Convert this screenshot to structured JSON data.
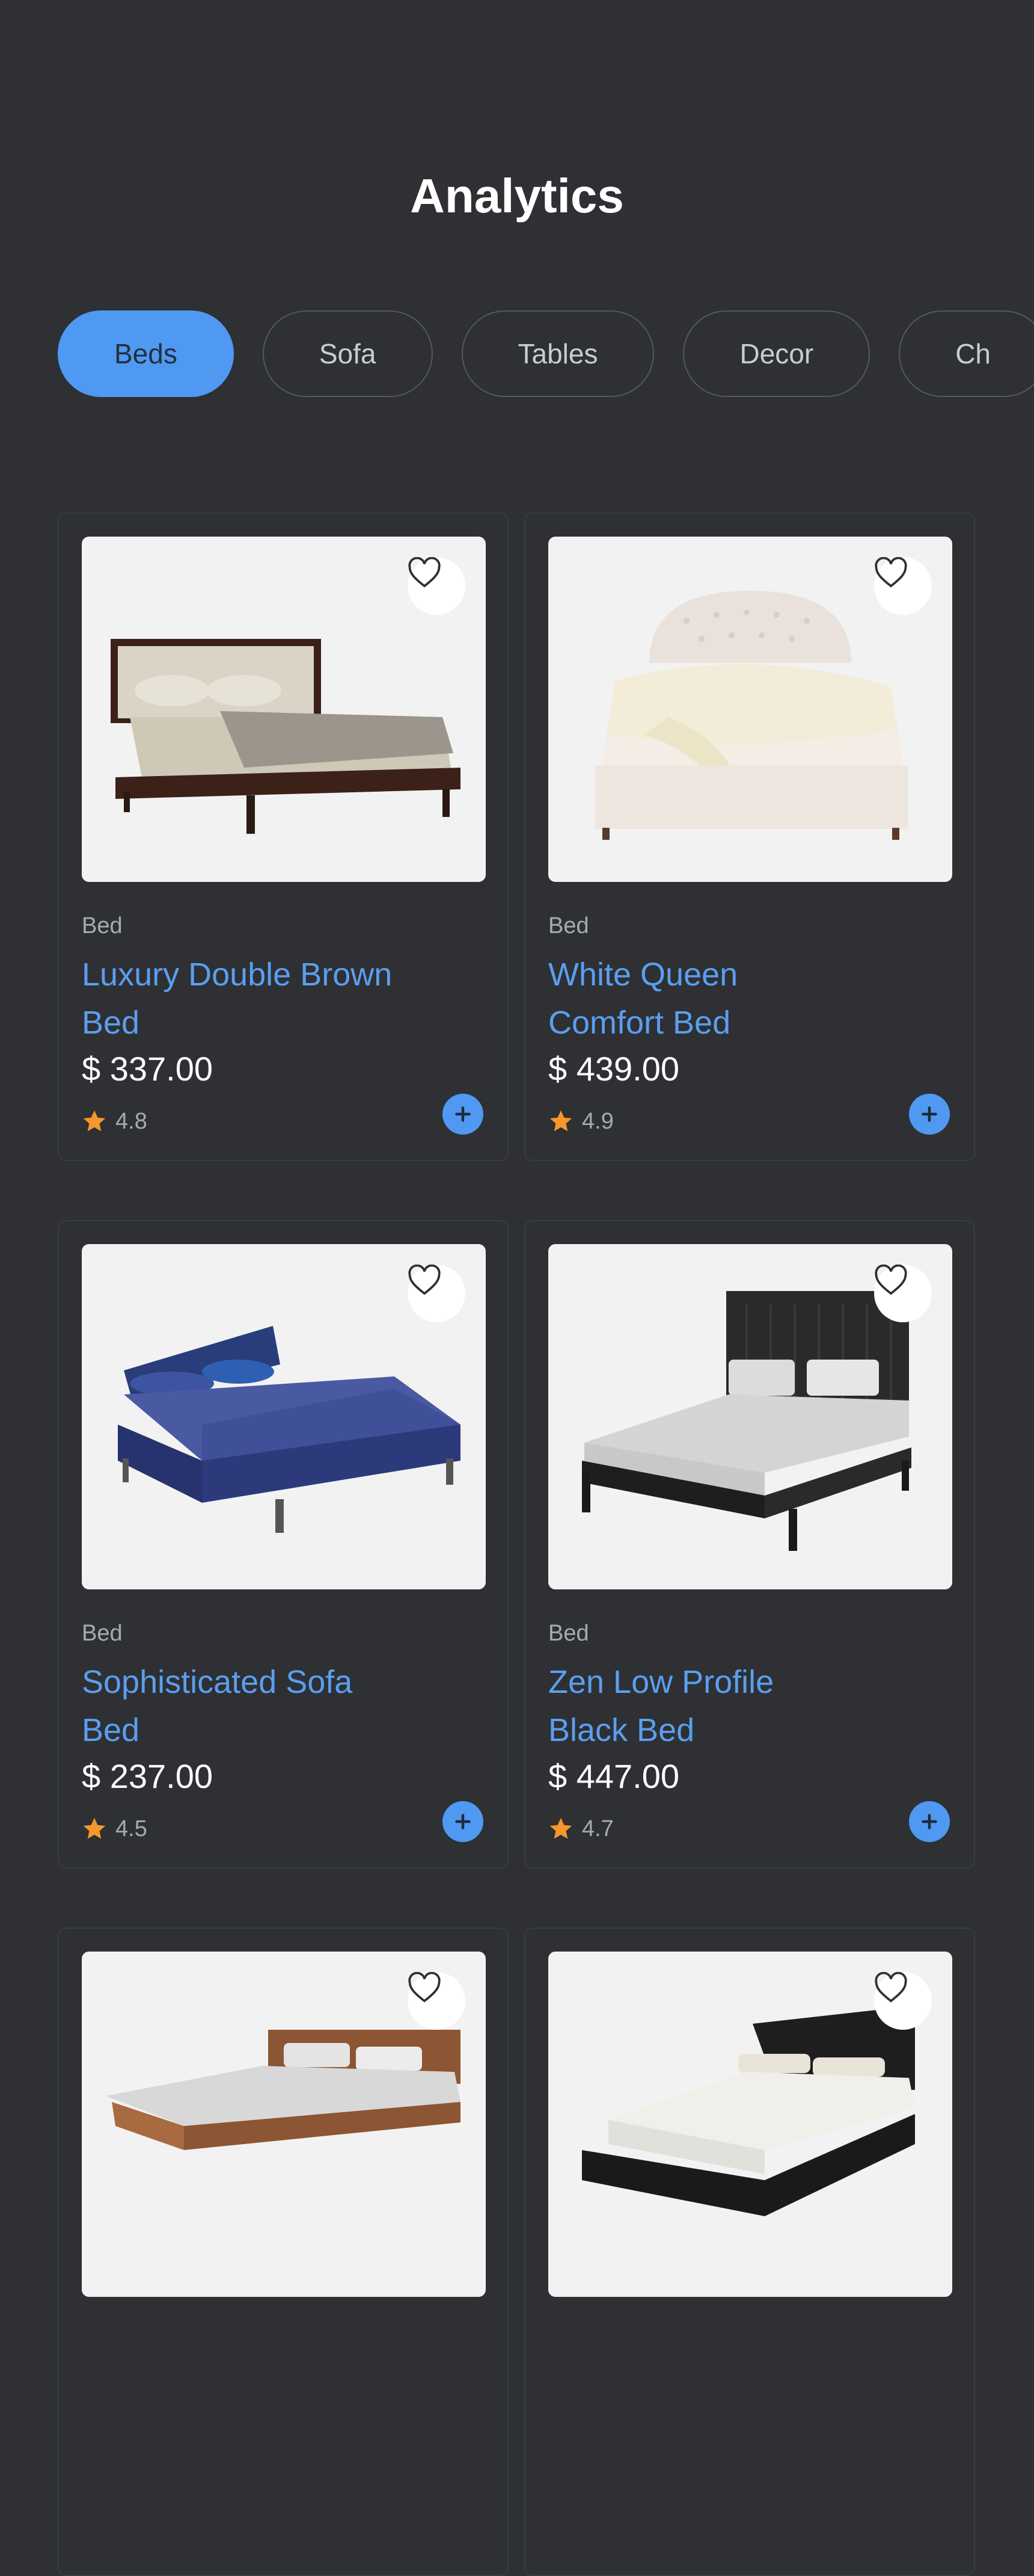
{
  "header": {
    "title": "Analytics"
  },
  "categories": [
    "Beds",
    "Sofa",
    "Tables",
    "Decor",
    "Ch"
  ],
  "products": [
    {
      "category": "Bed",
      "name": "Luxury Double Brown Bed",
      "price": "$ 337.00",
      "rating": "4.8"
    },
    {
      "category": "Bed",
      "name": "White Queen Comfort Bed",
      "price": "$ 439.00",
      "rating": "4.9"
    },
    {
      "category": "Bed",
      "name": "Sophisticated Sofa Bed",
      "price": "$ 237.00",
      "rating": "4.5"
    },
    {
      "category": "Bed",
      "name": "Zen Low Profile Black Bed",
      "price": "$ 447.00",
      "rating": "4.7"
    },
    {
      "category": "",
      "name": "",
      "price": "",
      "rating": ""
    },
    {
      "category": "",
      "name": "",
      "price": "",
      "rating": ""
    }
  ],
  "icons": {
    "favorite": "heart-icon",
    "rating": "star-icon",
    "add": "plus-icon"
  },
  "colors": {
    "background": "#2e3033",
    "accent": "#4f99f2",
    "star": "#f7962b"
  }
}
